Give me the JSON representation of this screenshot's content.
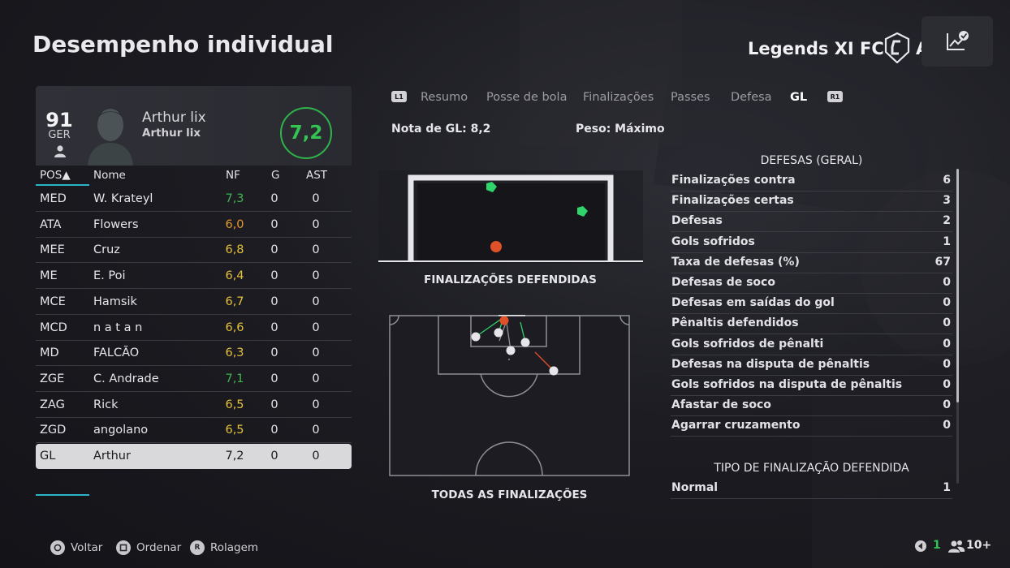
{
  "header": {
    "title": "Desempenho individual",
    "club_name": "Legends XI FC",
    "club_name_tail": "A"
  },
  "player_card": {
    "overall": "91",
    "nation": "GER",
    "name": "Arthur lix",
    "subname": "Arthur lix",
    "match_rating": "7,2"
  },
  "table": {
    "headers": {
      "pos": "POS▲",
      "name": "Nome",
      "nf": "NF",
      "g": "G",
      "ast": "AST"
    },
    "rows": [
      {
        "pos": "MED",
        "name": "W. Krateyl",
        "nf": "7,3",
        "g": "0",
        "ast": "0",
        "nf_color": "#3fb54f"
      },
      {
        "pos": "ATA",
        "name": "Flowers",
        "nf": "6,0",
        "g": "0",
        "ast": "0",
        "nf_color": "#e49a2c"
      },
      {
        "pos": "MEE",
        "name": "Cruz",
        "nf": "6,8",
        "g": "0",
        "ast": "0",
        "nf_color": "#e3c13a"
      },
      {
        "pos": "ME",
        "name": "E. Poi",
        "nf": "6,4",
        "g": "0",
        "ast": "0",
        "nf_color": "#e3c13a"
      },
      {
        "pos": "MCE",
        "name": "Hamsik",
        "nf": "6,7",
        "g": "0",
        "ast": "0",
        "nf_color": "#e3c13a"
      },
      {
        "pos": "MCD",
        "name": "n a t a n",
        "nf": "6,6",
        "g": "0",
        "ast": "0",
        "nf_color": "#e3c13a"
      },
      {
        "pos": "MD",
        "name": "FALCÃO",
        "nf": "6,3",
        "g": "0",
        "ast": "0",
        "nf_color": "#e3c13a"
      },
      {
        "pos": "ZGE",
        "name": "C. Andrade",
        "nf": "7,1",
        "g": "0",
        "ast": "0",
        "nf_color": "#3fb54f"
      },
      {
        "pos": "ZAG",
        "name": "Rick",
        "nf": "6,5",
        "g": "0",
        "ast": "0",
        "nf_color": "#e3c13a"
      },
      {
        "pos": "ZGD",
        "name": "angolano",
        "nf": "6,5",
        "g": "0",
        "ast": "0",
        "nf_color": "#e3c13a"
      },
      {
        "pos": "GL",
        "name": "Arthur",
        "nf": "7,2",
        "g": "0",
        "ast": "0",
        "nf_color": "#1a1a1f",
        "selected": true
      }
    ]
  },
  "tabs": {
    "left_trigger": "L1",
    "right_trigger": "R1",
    "items": [
      "Resumo",
      "Posse de bola",
      "Finalizações",
      "Passes",
      "Defesa",
      "GL"
    ],
    "active": "GL"
  },
  "gk": {
    "rating_label": "Nota de GL: 8,2",
    "weight_label": "Peso: Máximo"
  },
  "visuals": {
    "goal_caption": "FINALIZAÇÕES DEFENDIDAS",
    "pitch_caption": "TODAS AS FINALIZAÇÕES"
  },
  "stats": {
    "title": "DEFESAS (GERAL)",
    "rows": [
      {
        "label": "Finalizações contra",
        "value": "6"
      },
      {
        "label": "Finalizações certas",
        "value": "3"
      },
      {
        "label": "Defesas",
        "value": "2"
      },
      {
        "label": "Gols sofridos",
        "value": "1"
      },
      {
        "label": "Taxa de defesas (%)",
        "value": "67"
      },
      {
        "label": "Defesas de soco",
        "value": "0"
      },
      {
        "label": "Defesas em saídas do gol",
        "value": "0"
      },
      {
        "label": "Pênaltis defendidos",
        "value": "0"
      },
      {
        "label": "Gols sofridos de pênalti",
        "value": "0"
      },
      {
        "label": "Defesas na disputa de pênaltis",
        "value": "0"
      },
      {
        "label": "Gols sofridos na disputa de pênaltis",
        "value": "0"
      },
      {
        "label": "Afastar de soco",
        "value": "0"
      },
      {
        "label": "Agarrar cruzamento",
        "value": "0"
      }
    ],
    "type_title": "TIPO DE FINALIZAÇÃO DEFENDIDA",
    "type_rows": [
      {
        "label": "Normal",
        "value": "1"
      }
    ]
  },
  "footer": {
    "back": "Voltar",
    "sort": "Ordenar",
    "scroll": "Rolagem",
    "scroll_key": "R",
    "count": "1",
    "players": "10+"
  },
  "colors": {
    "accent": "#2bb3c8",
    "good": "#3fb54f",
    "average": "#e3c13a",
    "poor": "#e49a2c",
    "save_marker": "#2fd46a",
    "goal_marker": "#e0512a"
  }
}
